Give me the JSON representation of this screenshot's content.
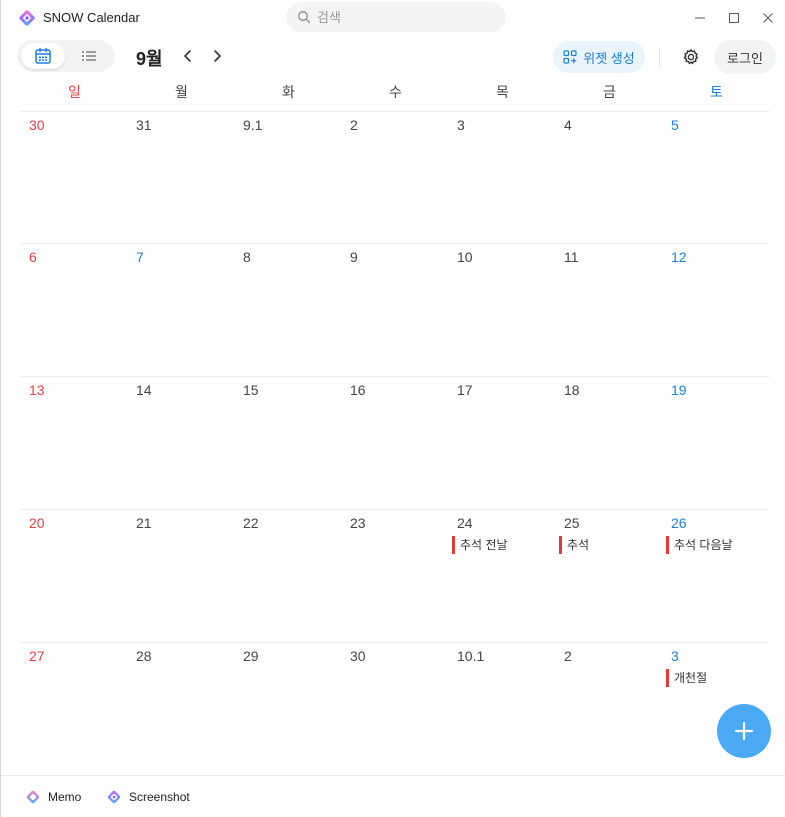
{
  "window": {
    "title": "SNOW Calendar",
    "controls": {
      "minimize": "—",
      "maximize": "☐",
      "close": "✕"
    }
  },
  "search": {
    "placeholder": "검색",
    "value": ""
  },
  "toolbar": {
    "month": "9월",
    "widget_label": "위젯 생성",
    "login_label": "로그인"
  },
  "weekdays": [
    "일",
    "월",
    "화",
    "수",
    "목",
    "금",
    "토"
  ],
  "weeks": [
    {
      "days": [
        {
          "label": "30",
          "type": "sun",
          "events": []
        },
        {
          "label": "31",
          "type": "",
          "events": []
        },
        {
          "label": "9.1",
          "type": "",
          "events": []
        },
        {
          "label": "2",
          "type": "",
          "events": []
        },
        {
          "label": "3",
          "type": "",
          "events": []
        },
        {
          "label": "4",
          "type": "",
          "events": []
        },
        {
          "label": "5",
          "type": "sat",
          "events": []
        }
      ]
    },
    {
      "days": [
        {
          "label": "6",
          "type": "sun",
          "events": []
        },
        {
          "label": "7",
          "type": "sat",
          "events": []
        },
        {
          "label": "8",
          "type": "",
          "events": []
        },
        {
          "label": "9",
          "type": "",
          "events": []
        },
        {
          "label": "10",
          "type": "",
          "events": []
        },
        {
          "label": "11",
          "type": "",
          "events": []
        },
        {
          "label": "12",
          "type": "sat",
          "events": []
        }
      ]
    },
    {
      "days": [
        {
          "label": "13",
          "type": "sun",
          "events": []
        },
        {
          "label": "14",
          "type": "",
          "events": []
        },
        {
          "label": "15",
          "type": "",
          "events": []
        },
        {
          "label": "16",
          "type": "",
          "events": []
        },
        {
          "label": "17",
          "type": "",
          "events": []
        },
        {
          "label": "18",
          "type": "",
          "events": []
        },
        {
          "label": "19",
          "type": "sat",
          "events": []
        }
      ]
    },
    {
      "days": [
        {
          "label": "20",
          "type": "sun",
          "events": []
        },
        {
          "label": "21",
          "type": "",
          "events": []
        },
        {
          "label": "22",
          "type": "",
          "events": []
        },
        {
          "label": "23",
          "type": "",
          "events": []
        },
        {
          "label": "24",
          "type": "",
          "events": [
            "추석 전날"
          ]
        },
        {
          "label": "25",
          "type": "",
          "events": [
            "추석"
          ]
        },
        {
          "label": "26",
          "type": "sat",
          "events": [
            "추석 다음날"
          ]
        }
      ]
    },
    {
      "days": [
        {
          "label": "27",
          "type": "sun",
          "events": []
        },
        {
          "label": "28",
          "type": "",
          "events": []
        },
        {
          "label": "29",
          "type": "",
          "events": []
        },
        {
          "label": "30",
          "type": "",
          "events": []
        },
        {
          "label": "10.1",
          "type": "",
          "events": []
        },
        {
          "label": "2",
          "type": "",
          "events": []
        },
        {
          "label": "3",
          "type": "sat",
          "events": [
            "개천절"
          ]
        }
      ]
    }
  ],
  "footer": {
    "memo_label": "Memo",
    "screenshot_label": "Screenshot"
  },
  "colors": {
    "sunday": "#e84040",
    "saturday": "#1c7fe0",
    "accent": "#4aaaf5",
    "event_bar": "#e53935"
  }
}
